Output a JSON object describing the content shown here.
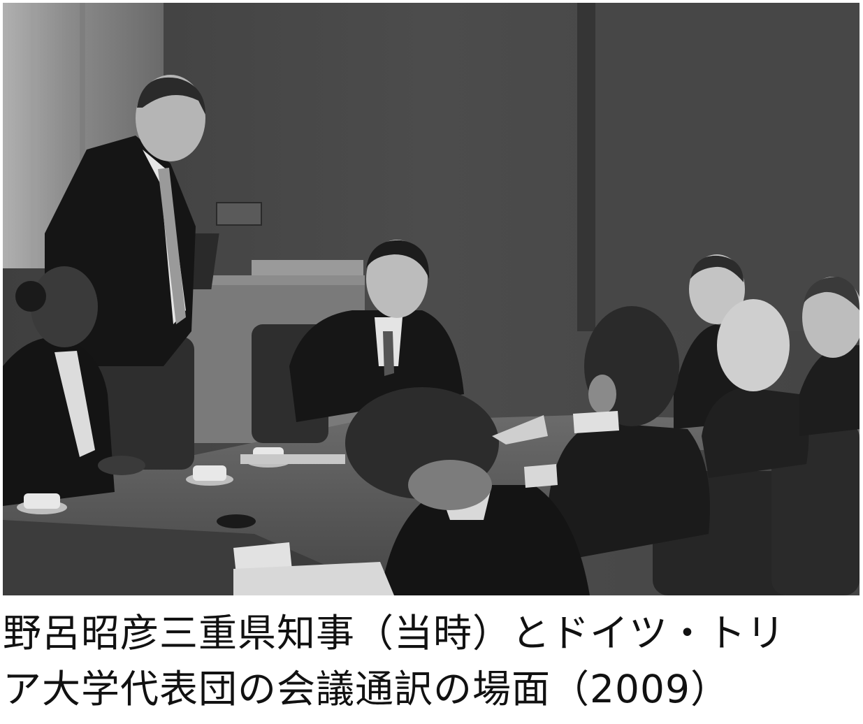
{
  "caption": {
    "line1": "野呂昭彦三重県知事（当時）とドイツ・トリ",
    "line2": "ア大学代表団の会議通訳の場面（2009）"
  },
  "photo": {
    "tone": "grayscale",
    "colors": {
      "wall": "#4a4a4a",
      "curtain": "#9a9a9a",
      "table": "#5c5c5c",
      "suit": "#151515",
      "chair": "#2e2e2e",
      "paper": "#d8d8d8"
    }
  }
}
